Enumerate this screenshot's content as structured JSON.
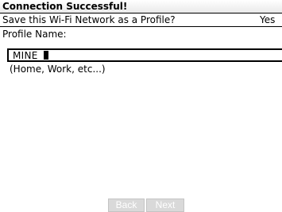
{
  "header": {
    "title": "Connection Successful!"
  },
  "save_profile": {
    "label": "Save this Wi-Fi Network as a Profile?",
    "value": "Yes"
  },
  "profile_name": {
    "label": "Profile Name:",
    "value": "MINE_",
    "hint": "(Home, Work, etc...)"
  },
  "navigation": {
    "back_label": "Back",
    "next_label": "Next"
  },
  "colors": {
    "background": "#ffffff",
    "text": "#000000",
    "disabled_button": "#d9d9d9"
  }
}
